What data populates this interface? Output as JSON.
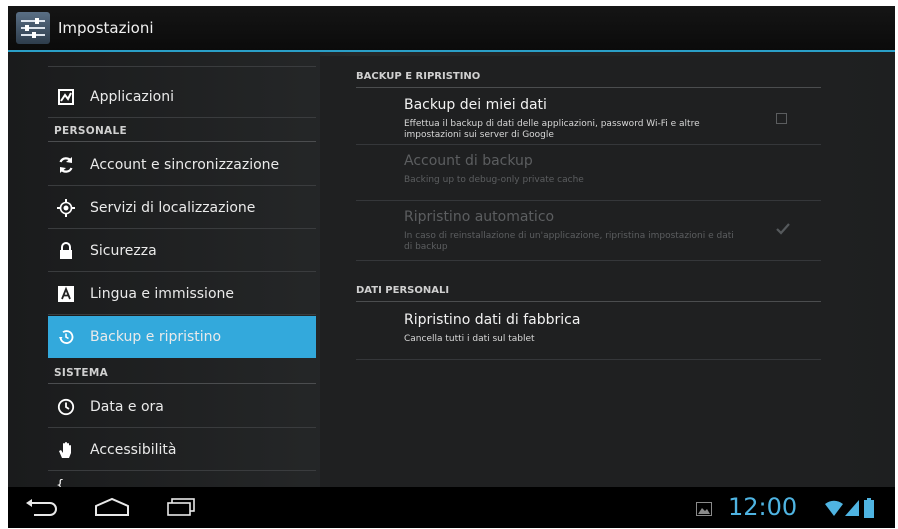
{
  "action_bar": {
    "title": "Impostazioni",
    "icon": "settings-icon"
  },
  "left_menu": {
    "items_top": [
      {
        "label": "Applicazioni",
        "icon": "apps-icon"
      }
    ],
    "section_personale": "PERSONALE",
    "items_personale": [
      {
        "label": "Account e sincronizzazione",
        "icon": "sync-icon"
      },
      {
        "label": "Servizi di localizzazione",
        "icon": "location-icon"
      },
      {
        "label": "Sicurezza",
        "icon": "lock-icon"
      },
      {
        "label": "Lingua e immissione",
        "icon": "keyboard-icon"
      },
      {
        "label": "Backup e ripristino",
        "icon": "backup-icon",
        "selected": true
      }
    ],
    "section_sistema": "SISTEMA",
    "items_sistema": [
      {
        "label": "Data e ora",
        "icon": "clock-icon"
      },
      {
        "label": "Accessibilità",
        "icon": "hand-icon"
      }
    ]
  },
  "right_pane": {
    "section_backup": "BACKUP E RIPRISTINO",
    "backup_dati": {
      "title": "Backup dei miei dati",
      "subtitle": "Effettua il backup di dati delle applicazioni, password Wi-Fi e altre impostazioni sui server di Google",
      "checked": false
    },
    "account_backup": {
      "title": "Account di backup",
      "subtitle": "Backing up to debug-only private cache"
    },
    "ripristino_auto": {
      "title": "Ripristino automatico",
      "subtitle": "In caso di reinstallazione di un'applicazione, ripristina impostazioni e dati di backup",
      "checked": true
    },
    "section_personali": "DATI PERSONALI",
    "factory_reset": {
      "title": "Ripristino dati di fabbrica",
      "subtitle": "Cancella tutti i dati sul tablet"
    }
  },
  "nav_bar": {
    "clock": "12:00",
    "accent_color": "#33a9dc"
  }
}
